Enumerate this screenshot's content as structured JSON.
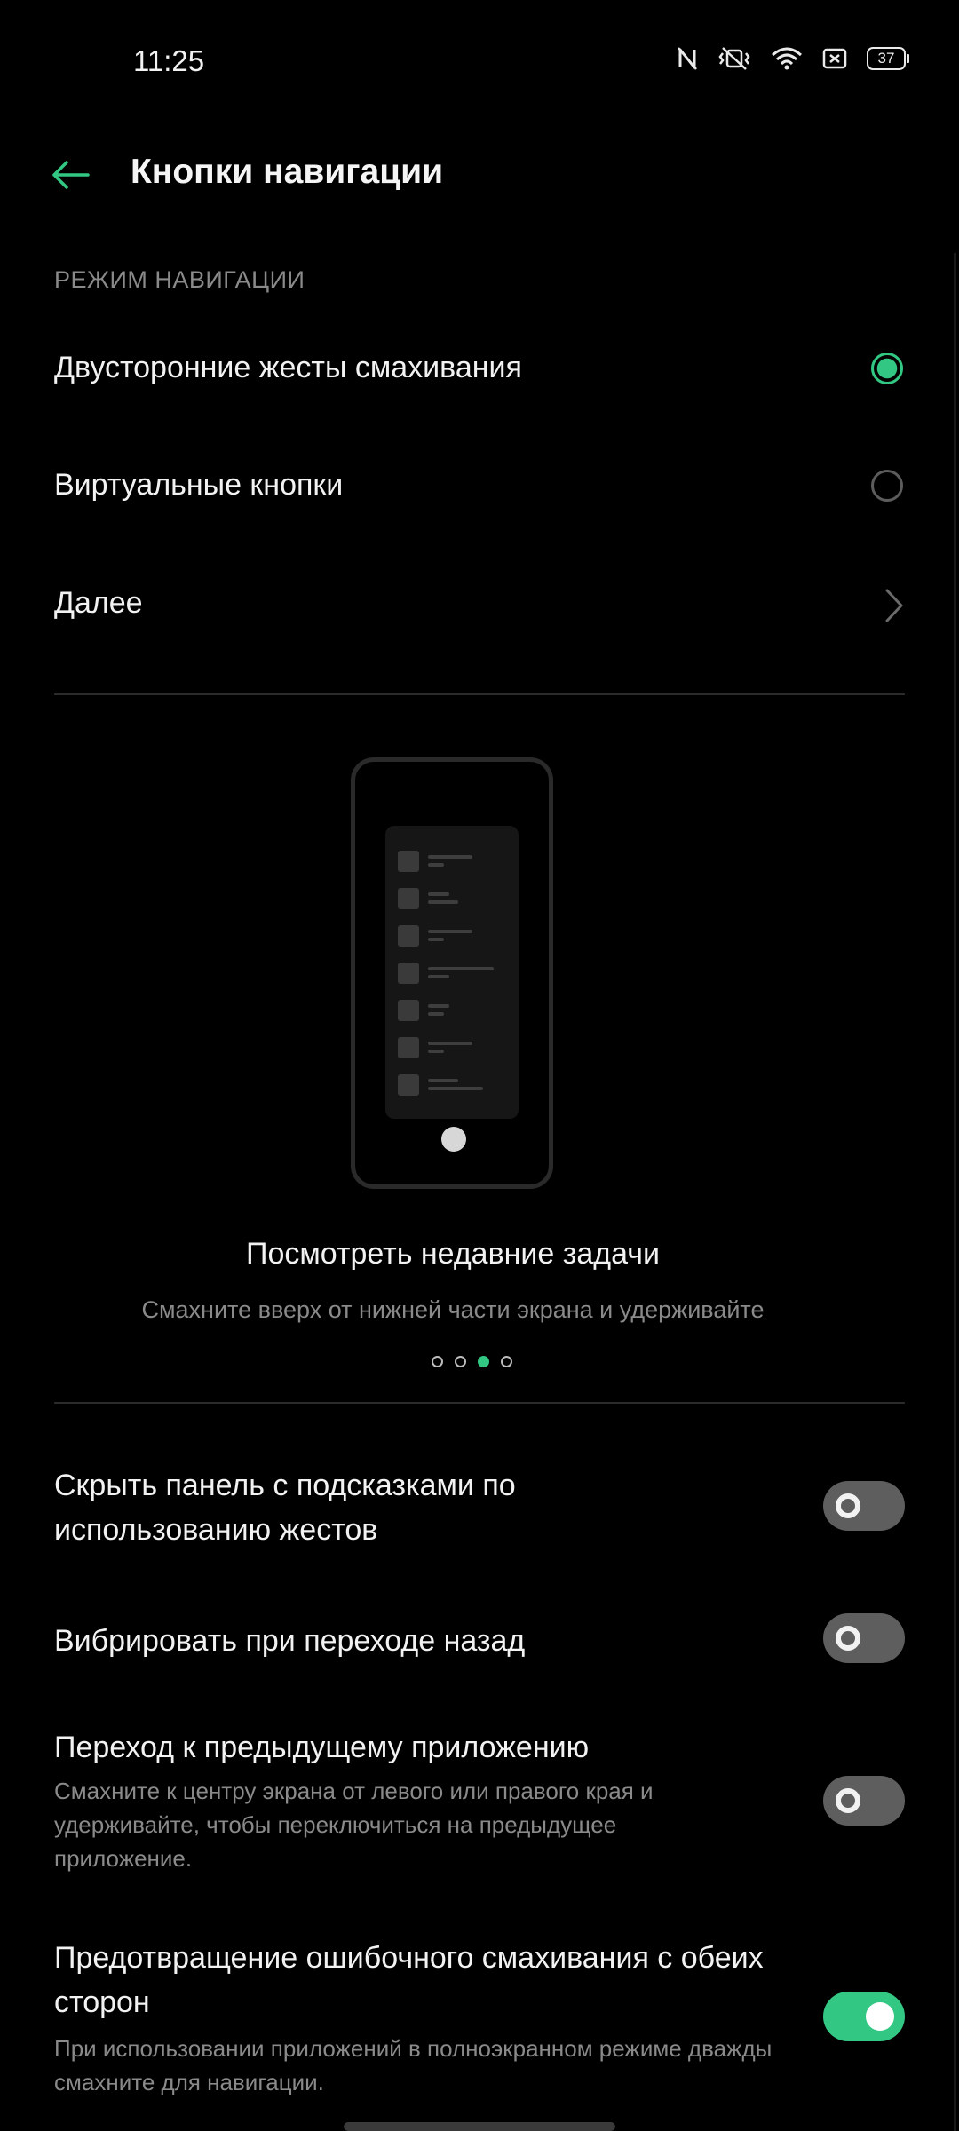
{
  "status_bar": {
    "time": "11:25",
    "battery": "37",
    "icons": [
      "nfc-icon",
      "vibrate-icon",
      "wifi-icon",
      "screen-record-icon",
      "battery-icon"
    ]
  },
  "header": {
    "title": "Кнопки навигации",
    "back_icon": "arrow-left-icon"
  },
  "nav_mode": {
    "section_label": "РЕЖИМ НАВИГАЦИИ",
    "options": [
      {
        "label": "Двусторонние жесты смахивания",
        "selected": true
      },
      {
        "label": "Виртуальные кнопки",
        "selected": false
      }
    ],
    "more_label": "Далее"
  },
  "illustration": {
    "title": "Посмотреть недавние задачи",
    "subtitle": "Смахните вверх от нижней части экрана и удерживайте",
    "page_count": 4,
    "active_page": 3
  },
  "settings": [
    {
      "title": "Скрыть панель с подсказками по использованию жестов",
      "description": "",
      "enabled": false
    },
    {
      "title": "Вибрировать при переходе назад",
      "description": "",
      "enabled": false
    },
    {
      "title": "Переход к предыдущему приложению",
      "description": "Смахните к центру экрана от левого или правого края и удерживайте, чтобы переключиться на предыдущее приложение.",
      "enabled": false
    },
    {
      "title": "Предотвращение ошибочного смахивания с обеих сторон",
      "description": "При использовании приложений в полноэкранном режиме дважды смахните для навигации.",
      "enabled": true
    }
  ],
  "colors": {
    "accent": "#32c883",
    "background": "#000000",
    "secondary_text": "#8a8a8a"
  }
}
